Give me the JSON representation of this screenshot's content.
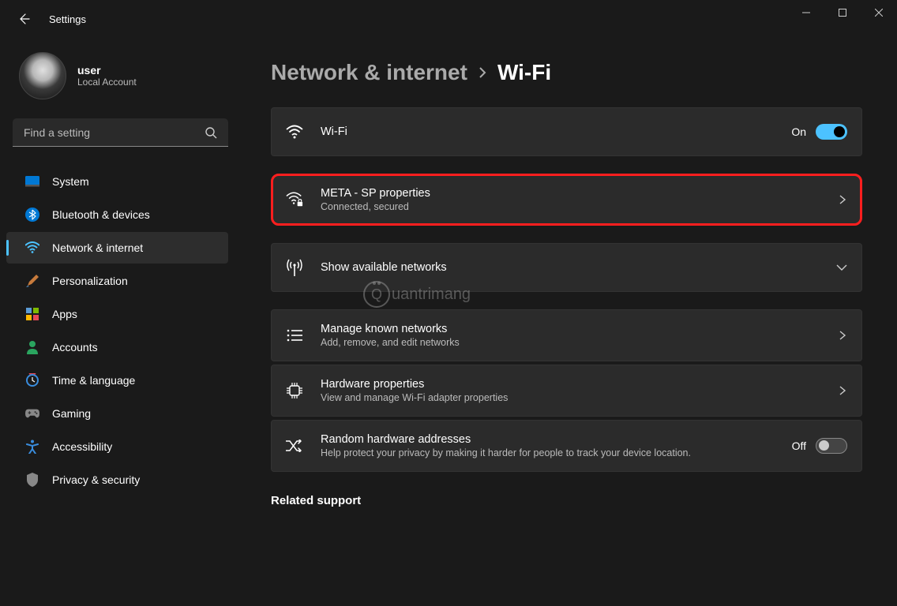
{
  "app_title": "Settings",
  "user": {
    "name": "user",
    "subtitle": "Local Account"
  },
  "search": {
    "placeholder": "Find a setting"
  },
  "nav": {
    "system": "System",
    "bluetooth": "Bluetooth & devices",
    "network": "Network & internet",
    "personalization": "Personalization",
    "apps": "Apps",
    "accounts": "Accounts",
    "time": "Time & language",
    "gaming": "Gaming",
    "accessibility": "Accessibility",
    "privacy": "Privacy & security"
  },
  "breadcrumb": {
    "parent": "Network & internet",
    "current": "Wi-Fi"
  },
  "cards": {
    "wifi": {
      "title": "Wi-Fi",
      "state": "On"
    },
    "network": {
      "title": "META - SP properties",
      "sub": "Connected, secured"
    },
    "available": {
      "title": "Show available networks"
    },
    "known": {
      "title": "Manage known networks",
      "sub": "Add, remove, and edit networks"
    },
    "hardware": {
      "title": "Hardware properties",
      "sub": "View and manage Wi-Fi adapter properties"
    },
    "random": {
      "title": "Random hardware addresses",
      "sub": "Help protect your privacy by making it harder for people to track your device location.",
      "state": "Off"
    }
  },
  "related_heading": "Related support",
  "watermark": "uantrimang"
}
